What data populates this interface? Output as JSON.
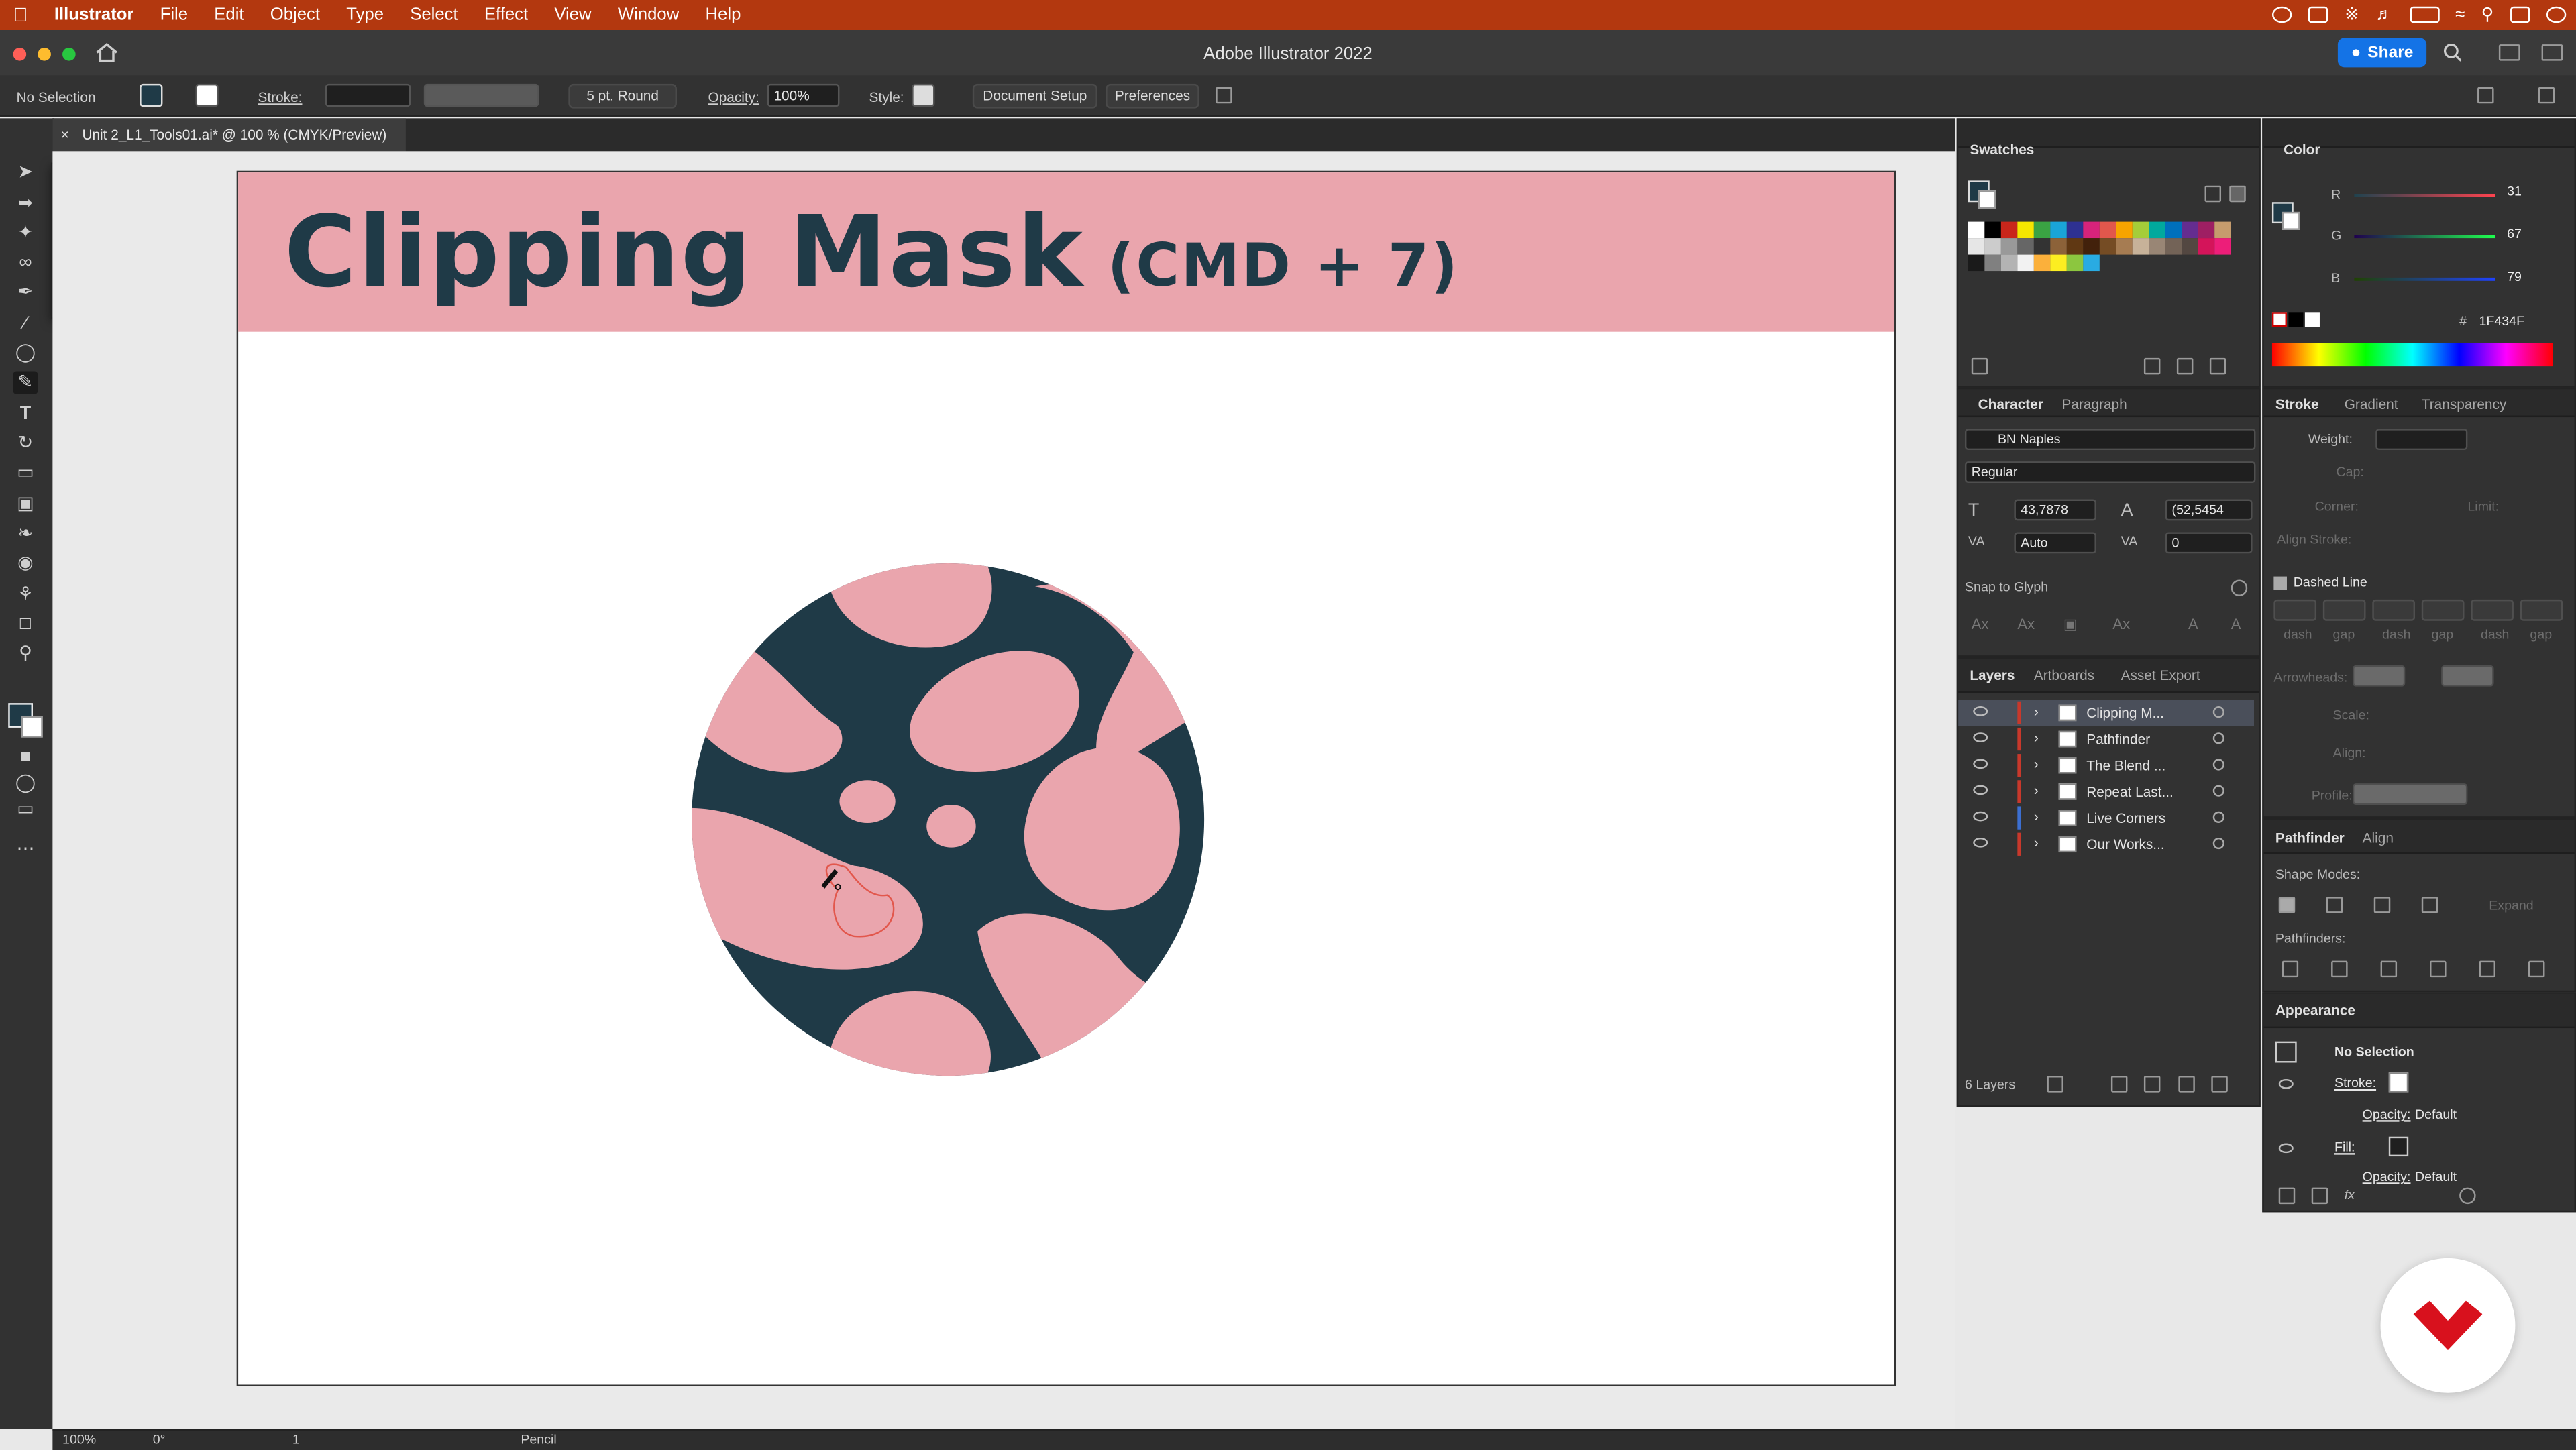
{
  "menubar": {
    "app": "Illustrator",
    "items": [
      "File",
      "Edit",
      "Object",
      "Type",
      "Select",
      "Effect",
      "View",
      "Window",
      "Help"
    ]
  },
  "window": {
    "title": "Adobe Illustrator 2022",
    "share": "Share"
  },
  "control": {
    "selection": "No Selection",
    "stroke_label": "Stroke:",
    "brush": "5 pt. Round",
    "opacity_label": "Opacity:",
    "opacity": "100%",
    "style_label": "Style:",
    "document_setup": "Document Setup",
    "preferences": "Preferences"
  },
  "document": {
    "tab": "Unit 2_L1_Tools01.ai* @ 100 % (CMYK/Preview)"
  },
  "artboard": {
    "title": "Clipping Mask",
    "subtitle": "(CMD + 7)"
  },
  "colors": {
    "banner": "#EAA5AD",
    "dark": "#1F3A47",
    "accent": "#B3380F"
  },
  "swatches": {
    "title": "Swatches"
  },
  "color_panel": {
    "title": "Color",
    "r_label": "R",
    "r": "31",
    "g_label": "G",
    "g": "67",
    "b_label": "B",
    "b": "79",
    "hex_label": "#",
    "hex": "1F434F"
  },
  "character": {
    "tabs": [
      "Character",
      "Paragraph"
    ],
    "font": "BN Naples",
    "style": "Regular",
    "size": "43,7878",
    "leading": "(52,5454",
    "kerning": "Auto",
    "tracking": "0",
    "snap": "Snap to Glyph"
  },
  "stroke_panel": {
    "tabs": [
      "Stroke",
      "Gradient",
      "Transparency"
    ],
    "weight": "Weight:",
    "cap": "Cap:",
    "corner": "Corner:",
    "limit": "Limit:",
    "align": "Align Stroke:",
    "dashed": "Dashed Line",
    "dash": "dash",
    "gap": "gap",
    "arrowheads": "Arrowheads:",
    "scale": "Scale:",
    "align2": "Align:",
    "profile": "Profile:"
  },
  "layers": {
    "tabs": [
      "Layers",
      "Artboards",
      "Asset Export"
    ],
    "items": [
      {
        "name": "Clipping M...",
        "color": "#c9382b"
      },
      {
        "name": "Pathfinder",
        "color": "#c9382b"
      },
      {
        "name": "The Blend ...",
        "color": "#c9382b"
      },
      {
        "name": "Repeat Last...",
        "color": "#c9382b"
      },
      {
        "name": "Live Corners",
        "color": "#3c6fd1"
      },
      {
        "name": "Our Works...",
        "color": "#c9382b"
      }
    ],
    "count": "6 Layers"
  },
  "pathfinder": {
    "tabs": [
      "Pathfinder",
      "Align"
    ],
    "shape_modes": "Shape Modes:",
    "expand": "Expand",
    "pathfinders": "Pathfinders:"
  },
  "appearance": {
    "title": "Appearance",
    "selection": "No Selection",
    "stroke": "Stroke:",
    "opacity1": "Opacity:",
    "default1": "Default",
    "fill": "Fill:",
    "opacity2": "Opacity:",
    "default2": "Default"
  },
  "status": {
    "zoom": "100%",
    "rotation": "0°",
    "artboard": "1",
    "tool": "Pencil"
  }
}
